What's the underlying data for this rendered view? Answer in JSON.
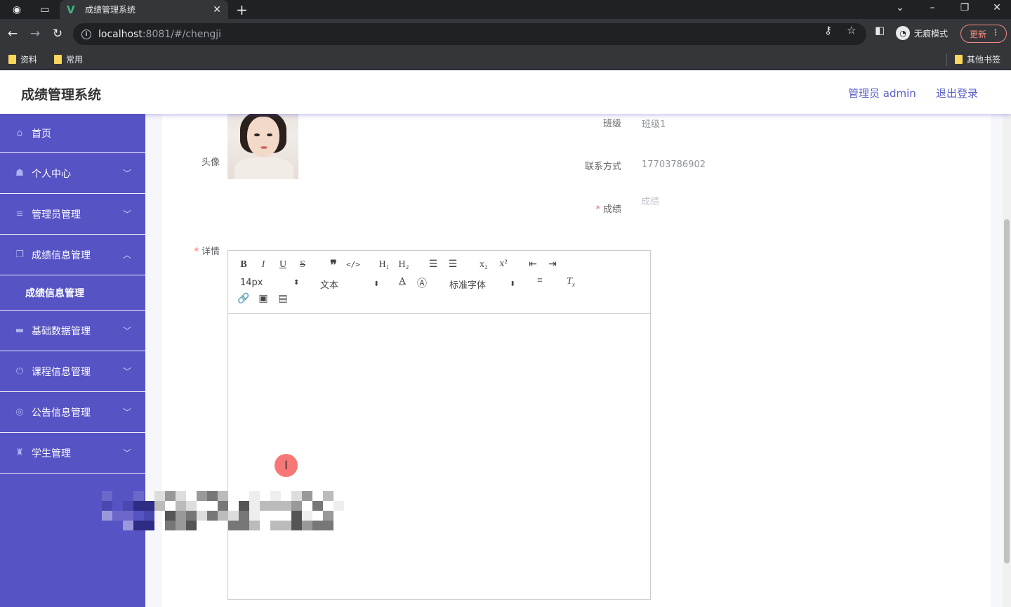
{
  "browser": {
    "tab_title": "成绩管理系统",
    "url_host": "localhost",
    "url_rest": ":8081/#/chengji",
    "profile_label": "无痕模式",
    "update_label": "更新",
    "bookmarks": [
      "资料",
      "常用"
    ],
    "other_bookmarks": "其他书签"
  },
  "header": {
    "title": "成绩管理系统",
    "user": "管理员 admin",
    "logout": "退出登录"
  },
  "sidebar": {
    "items": [
      {
        "label": "首页",
        "icon": "home-icon"
      },
      {
        "label": "个人中心",
        "icon": "user-icon"
      },
      {
        "label": "管理员管理",
        "icon": "list-icon"
      },
      {
        "label": "成绩信息管理",
        "icon": "copy-icon"
      },
      {
        "label": "基础数据管理",
        "icon": "monitor-icon"
      },
      {
        "label": "课程信息管理",
        "icon": "power-icon"
      },
      {
        "label": "公告信息管理",
        "icon": "compass-icon"
      },
      {
        "label": "学生管理",
        "icon": "podium-icon"
      }
    ],
    "sub_item": "成绩信息管理"
  },
  "form": {
    "class_label": "班级",
    "class_value": "班级1",
    "avatar_label": "头像",
    "contact_label": "联系方式",
    "contact_value": "17703786902",
    "score_label": "成绩",
    "score_placeholder": "成绩",
    "detail_label": "详情"
  },
  "editor": {
    "font_size": "14px",
    "header_select": "文本",
    "font_family": "标准字体"
  },
  "colors": {
    "sidebar": "#5653c4",
    "accent": "#5a5fc4",
    "required": "#f56c6c"
  }
}
